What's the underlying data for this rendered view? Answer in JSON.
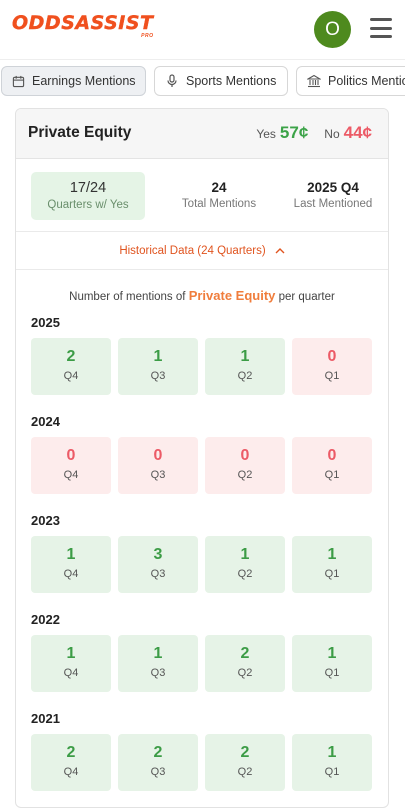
{
  "header": {
    "logo_text": "ODDSASSIST",
    "logo_sub": "PRO",
    "avatar_letter": "O",
    "brand_color": "#f0501e"
  },
  "tabs": [
    {
      "label": "Earnings Mentions",
      "icon": "calendar-icon",
      "active": true
    },
    {
      "label": "Sports Mentions",
      "icon": "microphone-icon",
      "active": false
    },
    {
      "label": "Politics Mentions",
      "icon": "bank-icon",
      "active": false
    }
  ],
  "market": {
    "title": "Private Equity",
    "yes_label": "Yes",
    "yes_price": "57¢",
    "no_label": "No",
    "no_price": "44¢"
  },
  "stats": [
    {
      "value": "17/24",
      "label": "Quarters w/ Yes"
    },
    {
      "value": "24",
      "label": "Total Mentions"
    },
    {
      "value": "2025 Q4",
      "label": "Last Mentioned"
    }
  ],
  "history": {
    "toggle_label": "Historical Data (24 Quarters)",
    "caption_pre": "Number of mentions of",
    "caption_term": "Private Equity",
    "caption_post": "per quarter",
    "years": [
      {
        "year": "2025",
        "quarters": [
          {
            "count": "2",
            "q": "Q4"
          },
          {
            "count": "1",
            "q": "Q3"
          },
          {
            "count": "1",
            "q": "Q2"
          },
          {
            "count": "0",
            "q": "Q1"
          }
        ]
      },
      {
        "year": "2024",
        "quarters": [
          {
            "count": "0",
            "q": "Q4"
          },
          {
            "count": "0",
            "q": "Q3"
          },
          {
            "count": "0",
            "q": "Q2"
          },
          {
            "count": "0",
            "q": "Q1"
          }
        ]
      },
      {
        "year": "2023",
        "quarters": [
          {
            "count": "1",
            "q": "Q4"
          },
          {
            "count": "3",
            "q": "Q3"
          },
          {
            "count": "1",
            "q": "Q2"
          },
          {
            "count": "1",
            "q": "Q1"
          }
        ]
      },
      {
        "year": "2022",
        "quarters": [
          {
            "count": "1",
            "q": "Q4"
          },
          {
            "count": "1",
            "q": "Q3"
          },
          {
            "count": "2",
            "q": "Q2"
          },
          {
            "count": "1",
            "q": "Q1"
          }
        ]
      },
      {
        "year": "2021",
        "quarters": [
          {
            "count": "2",
            "q": "Q4"
          },
          {
            "count": "2",
            "q": "Q3"
          },
          {
            "count": "2",
            "q": "Q2"
          },
          {
            "count": "1",
            "q": "Q1"
          }
        ]
      }
    ]
  }
}
